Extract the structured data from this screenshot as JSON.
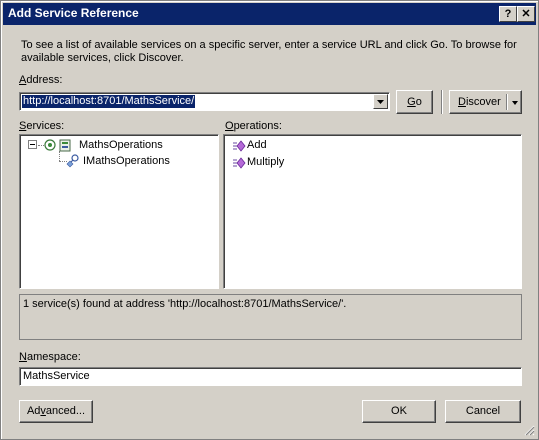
{
  "window": {
    "title": "Add Service Reference",
    "help_label": "?",
    "close_label": "✕"
  },
  "description": "To see a list of available services on a specific server, enter a service URL and click Go. To browse for available services, click Discover.",
  "address": {
    "label_hotkey": "A",
    "label_rest": "ddress:",
    "value": "http://localhost:8701/MathsService/"
  },
  "buttons": {
    "go_hotkey": "G",
    "go_rest": "o",
    "discover_hotkey": "D",
    "discover_rest": "iscover",
    "advanced_pre": "Ad",
    "advanced_hotkey": "v",
    "advanced_post": "anced...",
    "ok": "OK",
    "cancel": "Cancel"
  },
  "services": {
    "label_hotkey": "S",
    "label_rest": "ervices:",
    "tree": [
      {
        "label": "MathsOperations",
        "expanded": true
      },
      {
        "label": "IMathsOperations"
      }
    ]
  },
  "operations": {
    "label_hotkey": "O",
    "label_rest": "perations:",
    "items": [
      "Add",
      "Multiply"
    ]
  },
  "status_message": "1 service(s) found at address 'http://localhost:8701/MathsService/'.",
  "namespace": {
    "label_hotkey": "N",
    "label_rest": "amespace:",
    "value": "MathsService"
  },
  "colors": {
    "titlebar": "#0a246a",
    "selection": "#0a246a",
    "dialog_bg": "#d4d0c8"
  }
}
